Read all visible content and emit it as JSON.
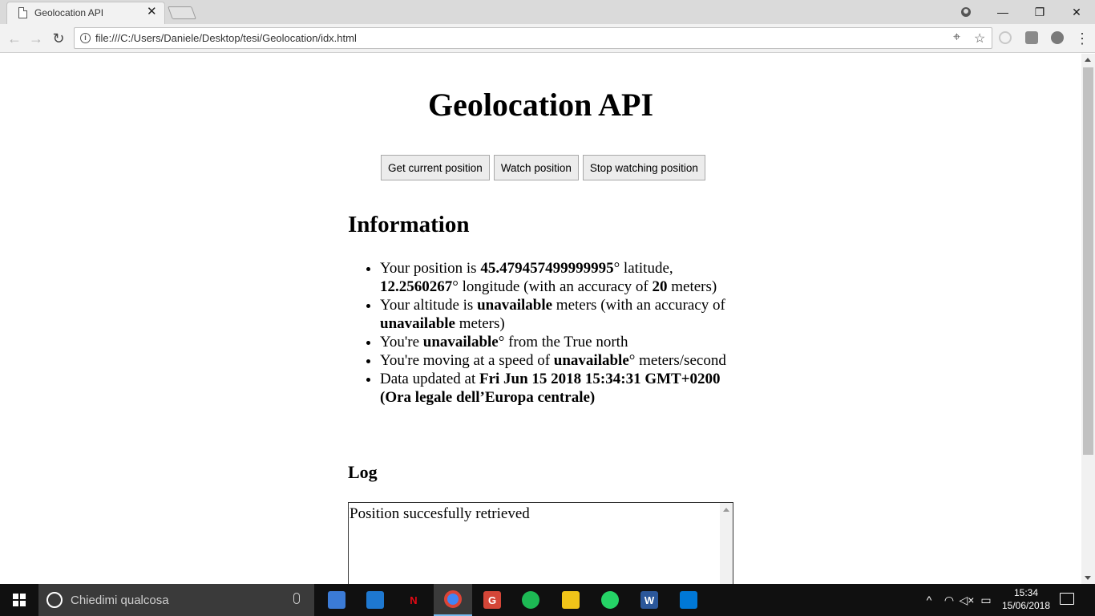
{
  "browser": {
    "tab_title": "Geolocation API",
    "tab_close": "✕",
    "url": "file:///C:/Users/Daniele/Desktop/tesi/Geolocation/idx.html",
    "back": "←",
    "forward": "→",
    "reload": "↻",
    "location_icon": "⌖",
    "star_icon": "☆",
    "menu_icon": "⋮",
    "window_controls": {
      "minimize": "—",
      "restore": "❐",
      "close": "✕"
    }
  },
  "page": {
    "title": "Geolocation API",
    "buttons": {
      "get_current": "Get current position",
      "watch": "Watch position",
      "stop": "Stop watching position"
    },
    "info_heading": "Information",
    "info": {
      "pos_prefix": "Your position is ",
      "latitude": "45.479457499999995",
      "lat_suffix": "° latitude, ",
      "longitude": "12.2560267",
      "lon_suffix": "° longitude (with an accuracy of ",
      "accuracy": "20",
      "acc_suffix": " meters)",
      "alt_prefix": "Your altitude is ",
      "altitude": "unavailable",
      "alt_mid": " meters (with an accuracy of ",
      "altitude_accuracy": "unavailable",
      "alt_suffix": " meters)",
      "heading_prefix": "You're ",
      "heading": "unavailable",
      "heading_suffix": "° from the True north",
      "speed_prefix": "You're moving at a speed of ",
      "speed": "unavailable",
      "speed_suffix": "° meters/second",
      "updated_prefix": "Data updated at ",
      "updated": "Fri Jun 15 2018 15:34:31 GMT+0200 (Ora legale dell’Europa centrale)"
    },
    "log_heading": "Log",
    "log_text": "Position succesfully retrieved"
  },
  "taskbar": {
    "search_placeholder": "Chiedimi qualcosa",
    "time": "15:34",
    "date": "15/06/2018",
    "apps": [
      {
        "name": "file-explorer",
        "color": "#f0c419"
      },
      {
        "name": "chrome",
        "color": "#4285f4"
      },
      {
        "name": "whatsapp",
        "color": "#25d366"
      },
      {
        "name": "word",
        "color": "#2b579a"
      },
      {
        "name": "vscode",
        "color": "#0078d7"
      }
    ]
  }
}
